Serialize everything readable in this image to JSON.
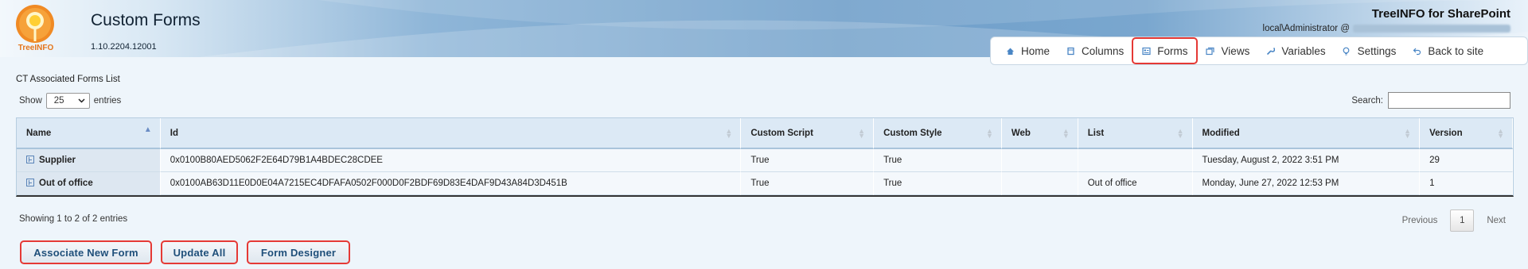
{
  "header": {
    "logo_text": "TreeINFO",
    "title": "Custom Forms",
    "version": "1.10.2204.12001",
    "product": "TreeINFO for SharePoint",
    "user": "local\\Administrator @"
  },
  "nav": {
    "items": [
      {
        "label": "Home",
        "icon": "home-icon"
      },
      {
        "label": "Columns",
        "icon": "columns-icon"
      },
      {
        "label": "Forms",
        "icon": "forms-icon",
        "active": true
      },
      {
        "label": "Views",
        "icon": "views-icon"
      },
      {
        "label": "Variables",
        "icon": "variables-icon"
      },
      {
        "label": "Settings",
        "icon": "settings-icon"
      },
      {
        "label": "Back to site",
        "icon": "back-icon"
      }
    ]
  },
  "list": {
    "title": "CT Associated Forms List",
    "show_label": "Show",
    "entries_value": "25",
    "entries_label": "entries",
    "search_label": "Search:",
    "search_placeholder": ""
  },
  "table": {
    "columns": [
      "Name",
      "Id",
      "Custom Script",
      "Custom Style",
      "Web",
      "List",
      "Modified",
      "Version"
    ],
    "rows": [
      {
        "name": "Supplier",
        "id": "0x0100B80AED5062F2E64D79B1A4BDEC28CDEE",
        "custom_script": "True",
        "custom_style": "True",
        "web": "",
        "list": "",
        "modified": "Tuesday, August 2, 2022 3:51 PM",
        "version": "29"
      },
      {
        "name": "Out of office",
        "id": "0x0100AB63D11E0D0E04A7215EC4DFAFA0502F000D0F2BDF69D83E4DAF9D43A84D3D451B",
        "custom_script": "True",
        "custom_style": "True",
        "web": "",
        "list": "Out of office",
        "modified": "Monday, June 27, 2022 12:53 PM",
        "version": "1"
      }
    ]
  },
  "footer": {
    "info": "Showing 1 to 2 of 2 entries",
    "previous": "Previous",
    "page": "1",
    "next": "Next"
  },
  "buttons": {
    "associate": "Associate New Form",
    "update_all": "Update All",
    "form_designer": "Form Designer"
  },
  "colors": {
    "accent": "#4a86c5",
    "highlight": "#e53935",
    "logo_orange": "#e4751b"
  }
}
